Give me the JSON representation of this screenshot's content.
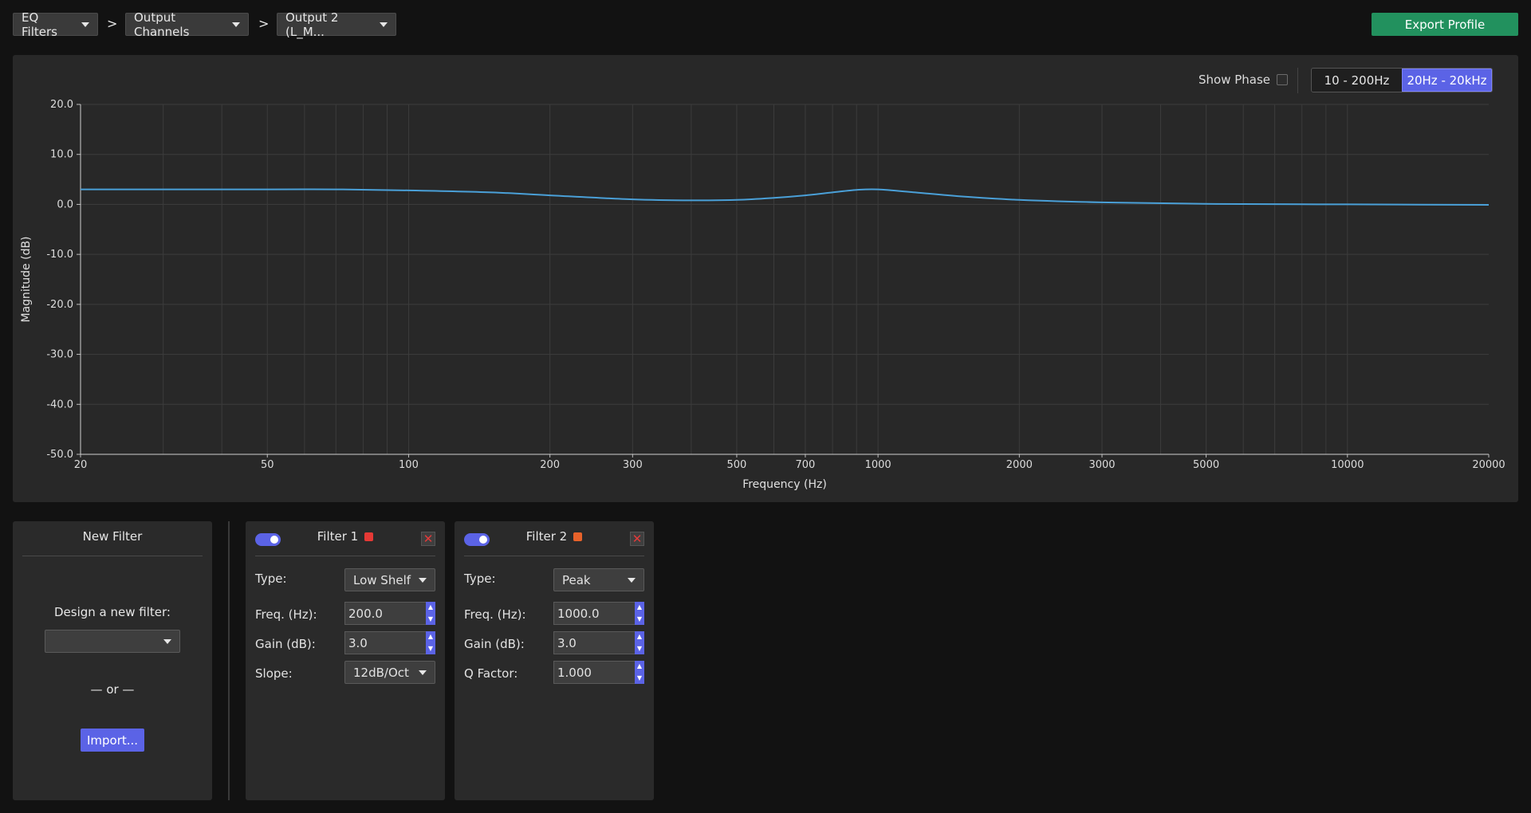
{
  "breadcrumb": {
    "items": [
      "EQ Filters",
      "Output Channels",
      "Output 2 (L_M..."
    ],
    "separator": ">"
  },
  "export_label": "Export Profile",
  "chart_controls": {
    "show_phase_label": "Show Phase",
    "show_phase_checked": false,
    "ranges": [
      "10 - 200Hz",
      "20Hz - 20kHz"
    ],
    "active_range": "20Hz - 20kHz"
  },
  "chart_data": {
    "type": "line",
    "xlabel": "Frequency (Hz)",
    "ylabel": "Magnitude (dB)",
    "xscale": "log",
    "xlim": [
      20,
      20000
    ],
    "ylim": [
      -50,
      20
    ],
    "x_ticks": [
      20,
      50,
      100,
      200,
      300,
      500,
      700,
      1000,
      2000,
      3000,
      5000,
      10000,
      20000
    ],
    "y_ticks": [
      "20.0",
      "10.0",
      "0.0",
      "-10.0",
      "-20.0",
      "-30.0",
      "-40.0",
      "-50.0"
    ],
    "grid": true,
    "series": [
      {
        "color": "#4aa0d8",
        "x": [
          20,
          30,
          50,
          70,
          100,
          150,
          200,
          300,
          400,
          500,
          600,
          700,
          800,
          900,
          1000,
          1200,
          1500,
          2000,
          3000,
          5000,
          10000,
          20000
        ],
        "y": [
          3.0,
          3.0,
          3.0,
          3.0,
          2.8,
          2.4,
          1.8,
          1.0,
          0.8,
          0.9,
          1.3,
          1.8,
          2.4,
          2.9,
          3.0,
          2.4,
          1.6,
          0.9,
          0.4,
          0.1,
          0.0,
          -0.1
        ]
      }
    ]
  },
  "new_filter": {
    "title": "New Filter",
    "design_label": "Design a new filter:",
    "design_value": "",
    "or_label": "— or —",
    "import_label": "Import..."
  },
  "filters": [
    {
      "title": "Filter 1",
      "enabled": true,
      "color": "#e53935",
      "type_label": "Type:",
      "type_value": "Low Shelf",
      "freq_label": "Freq. (Hz):",
      "freq_value": "200.0",
      "gain_label": "Gain (dB):",
      "gain_value": "3.0",
      "extra_label": "Slope:",
      "extra_value": "12dB/Oct"
    },
    {
      "title": "Filter 2",
      "enabled": true,
      "color": "#e8622a",
      "type_label": "Type:",
      "type_value": "Peak",
      "freq_label": "Freq. (Hz):",
      "freq_value": "1000.0",
      "gain_label": "Gain (dB):",
      "gain_value": "3.0",
      "extra_label": "Q Factor:",
      "extra_value": "1.000"
    }
  ]
}
